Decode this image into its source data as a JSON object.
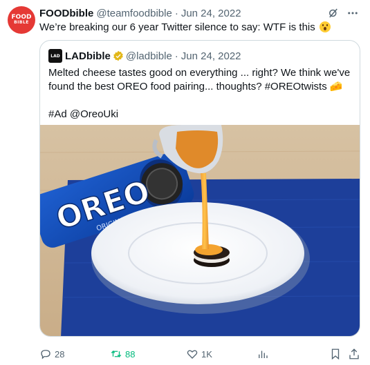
{
  "tweet": {
    "author_name": "FOODbible",
    "author_handle": "@teamfoodbible",
    "date": "Jun 24, 2022",
    "separator": "·",
    "text": "We’re breaking our 6 year Twitter silence to say: WTF is this",
    "avatar_text_1": "FOOD",
    "avatar_text_2": "BIBLE"
  },
  "quote": {
    "author_name": "LADbible",
    "author_handle": "@ladbible",
    "date": "Jun 24, 2022",
    "separator": "·",
    "avatar_text": "LAD",
    "text": "Melted cheese tastes good on everything ... right? We think we've found the best OREO food pairing... thoughts? #OREOtwists 🧀\n\n#Ad @OreoUki",
    "media": {
      "packet_brand": "OREO",
      "packet_sub": "ORIGINAL"
    }
  },
  "actions": {
    "replies": "28",
    "retweets": "88",
    "likes": "1K"
  },
  "colors": {
    "retweet": "#00ba7c",
    "muted": "#536471",
    "avatar_bg": "#e53935"
  }
}
